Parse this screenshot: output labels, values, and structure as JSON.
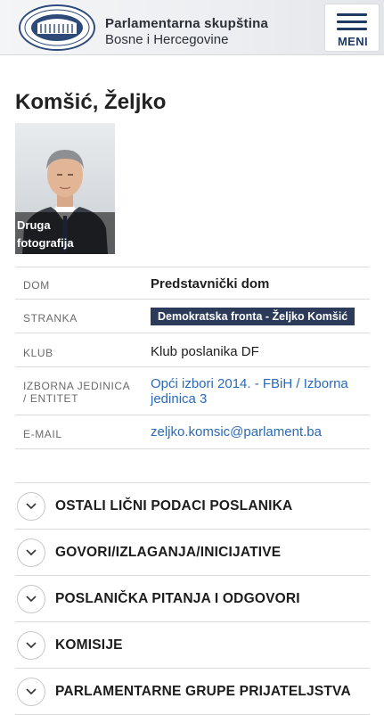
{
  "header": {
    "org_line1": "Parlamentarna skupština",
    "org_line2": "Bosne i Hercegovine",
    "menu_label": "MENI",
    "menu_icon": "hamburger-icon"
  },
  "profile": {
    "name": "Komšić, Željko",
    "photo_caption_line1": "Druga",
    "photo_caption_line2": "fotografija"
  },
  "info_rows": {
    "dom": {
      "label": "DOM",
      "value": "Predstavnički dom"
    },
    "stranka": {
      "label": "STRANKA",
      "value": "Demokratska fronta - Željko Komšić"
    },
    "klub": {
      "label": "KLUB",
      "value": "Klub poslanika DF"
    },
    "izborna": {
      "label_line1": "IZBORNA JEDINICA",
      "label_line2": "/ ENTITET",
      "value_line1": "Opći izbori 2014. - FBiH / Izborna",
      "value_line2": "jedinica 3"
    },
    "email": {
      "label": "E-MAIL",
      "value": "zeljko.komsic@parlament.ba"
    }
  },
  "accordions": [
    {
      "label": "OSTALI LIČNI PODACI POSLANIKA"
    },
    {
      "label": "GOVORI/IZLAGANJA/INICIJATIVE"
    },
    {
      "label": "POSLANIČKA PITANJA I ODGOVORI"
    },
    {
      "label": "KOMISIJE"
    },
    {
      "label": "PARLAMENTARNE GRUPE PRIJATELJSTVA"
    }
  ],
  "colors": {
    "brand_navy": "#1f3b63",
    "badge_bg": "#2c3b5a",
    "link": "#2a6ab8"
  }
}
